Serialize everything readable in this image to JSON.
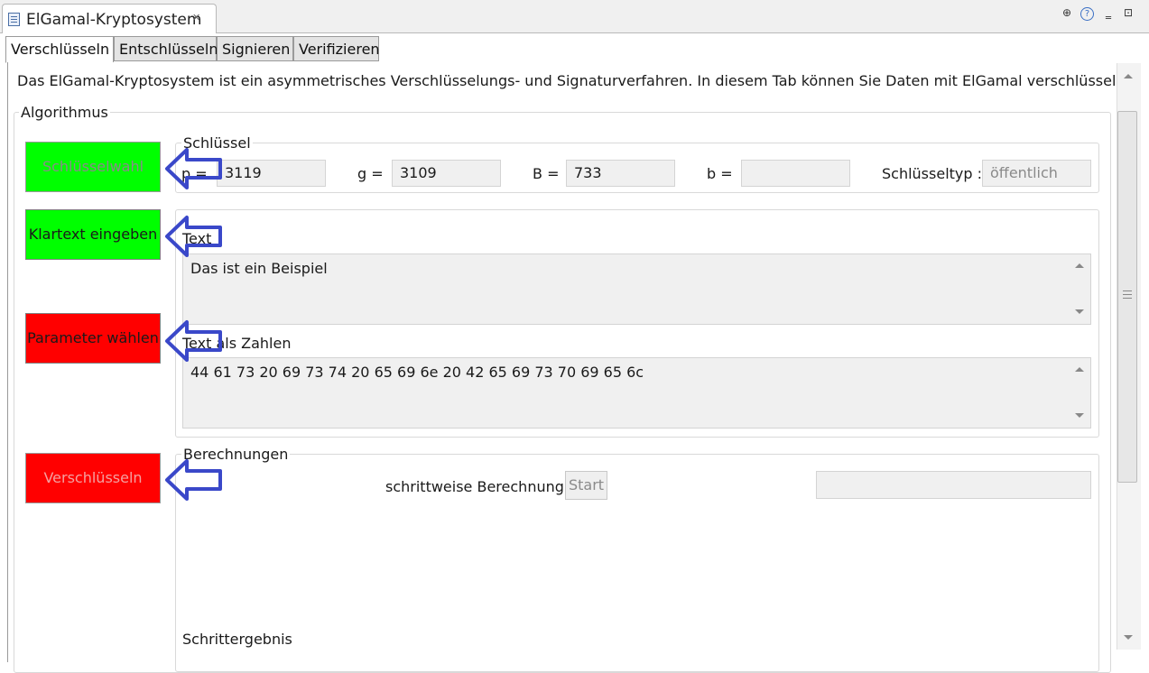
{
  "view": {
    "title": "ElGamal-Kryptosystem",
    "close_glyph": "✕"
  },
  "view_buttons": {
    "new_glyph": "⊕",
    "help_glyph": "?",
    "minimize_glyph": "‗",
    "maximize_glyph": "⊡"
  },
  "tabs": [
    {
      "label": "Verschlüsseln",
      "active": true
    },
    {
      "label": "Entschlüsseln",
      "active": false
    },
    {
      "label": "Signieren",
      "active": false
    },
    {
      "label": "Verifizieren",
      "active": false
    }
  ],
  "description": "Das ElGamal-Kryptosystem ist ein asymmetrisches Verschlüsselungs- und Signaturverfahren. In diesem Tab können Sie Daten mit ElGamal verschlüsseln.",
  "algorithm": {
    "group_label": "Algorithmus",
    "steps": [
      {
        "label": "Schlüsselwahl",
        "color": "#00ff00",
        "enabled": false
      },
      {
        "label": "Klartext eingeben",
        "color": "#00ff00",
        "enabled": true
      },
      {
        "label": "Parameter wählen",
        "color": "#ff0000",
        "enabled": true
      },
      {
        "label": "Verschlüsseln",
        "color": "#ff0000",
        "enabled": false
      }
    ],
    "arrow_color": "#3a48c9"
  },
  "key": {
    "group_label": "Schlüssel",
    "p_label": "p =",
    "p_value": "3119",
    "g_label": "g =",
    "g_value": "3109",
    "B_label": "B =",
    "B_value": "733",
    "b_label": "b =",
    "b_value": "",
    "type_label": "Schlüsseltyp :",
    "type_value": "öffentlich"
  },
  "text": {
    "text_label": "Text",
    "text_value": "Das ist ein Beispiel",
    "numbers_label": "Text als Zahlen",
    "numbers_value": "44 61 73 20 69 73 74 20 65 69 6e 20 42 65 69 73 70 69 65 6c"
  },
  "calc": {
    "group_label": "Berechnungen",
    "stepwise_label": "schrittweise Berechnung:",
    "start_label": "Start",
    "result_label": "Schrittergebnis"
  }
}
